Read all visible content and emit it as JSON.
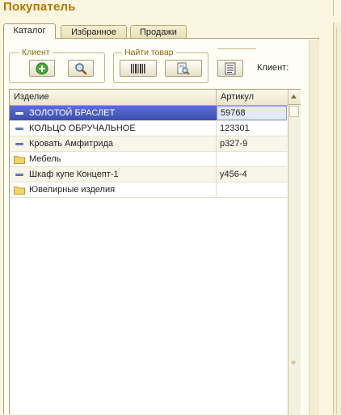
{
  "window": {
    "title": "Покупатель"
  },
  "tabs": [
    {
      "label": "Каталог",
      "active": true
    },
    {
      "label": "Избранное",
      "active": false
    },
    {
      "label": "Продажи",
      "active": false
    }
  ],
  "toolbar": {
    "client_group": {
      "legend": "Клиент",
      "buttons": [
        "add-icon",
        "search-icon"
      ]
    },
    "find_group": {
      "legend": "Найти товар",
      "buttons": [
        "barcode-icon",
        "find-document-icon"
      ]
    },
    "list_button": "list-icon",
    "client_label": "Клиент:"
  },
  "table": {
    "columns": [
      "Изделие",
      "Артикул"
    ],
    "rows": [
      {
        "icon": "item-icon",
        "name": "ЗОЛОТОЙ БРАСЛЕТ",
        "code": "59768",
        "selected": true
      },
      {
        "icon": "item-icon",
        "name": "КОЛЬЦО ОБРУЧАЛЬНОЕ",
        "code": "123301",
        "selected": false
      },
      {
        "icon": "item-icon",
        "name": "Кровать Амфитрида",
        "code": "р327-9",
        "selected": false
      },
      {
        "icon": "folder-icon",
        "name": "Мебель",
        "code": "",
        "selected": false
      },
      {
        "icon": "item-icon",
        "name": "Шкаф купе Концепт-1",
        "code": "у456-4",
        "selected": false
      },
      {
        "icon": "folder-icon",
        "name": "Ювелирные изделия",
        "code": "",
        "selected": false
      }
    ]
  },
  "colors": {
    "title": "#b37800",
    "selection": "#3c4fb0",
    "background": "#fbf6e0"
  }
}
